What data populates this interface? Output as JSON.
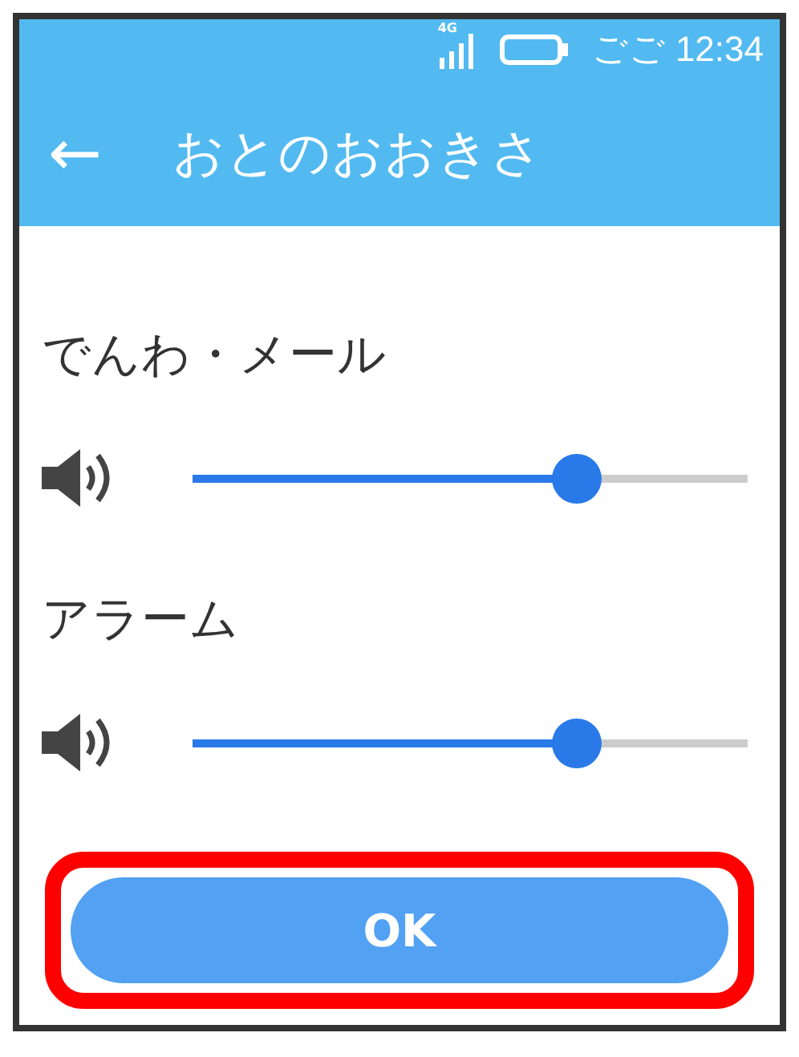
{
  "status_bar": {
    "network": "4G",
    "time": "ごご 12:34"
  },
  "header": {
    "back": "←",
    "title": "おとのおおきさ"
  },
  "volumes": [
    {
      "label": "でんわ・メール",
      "level": 0.69
    },
    {
      "label": "アラーム",
      "level": 0.69
    }
  ],
  "ok_button": {
    "label": "OK",
    "highlighted": true
  }
}
